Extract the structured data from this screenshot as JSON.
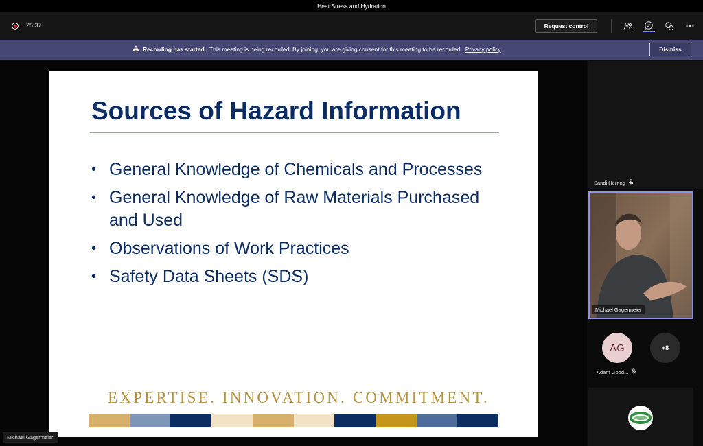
{
  "window": {
    "title": "Heat Stress and Hydration"
  },
  "meeting": {
    "timer": "25:37",
    "request_control_label": "Request control",
    "icons": [
      "people-icon",
      "chat-icon",
      "reactions-icon",
      "more-icon"
    ]
  },
  "banner": {
    "bold_text": "Recording has started.",
    "message": "This meeting is being recorded. By joining, you are giving consent for this meeting to be recorded.",
    "link_text": "Privacy policy",
    "dismiss_label": "Dismiss"
  },
  "slide": {
    "title": "Sources of Hazard Information",
    "bullets": [
      "General Knowledge of Chemicals and Processes",
      "General Knowledge of Raw Materials Purchased and Used",
      "Observations of Work Practices",
      "Safety Data Sheets (SDS)"
    ],
    "tagline": "EXPERTISE. INNOVATION. COMMITMENT.",
    "colorbar_colors": [
      "#d8b06a",
      "#7f96b8",
      "#0b2d63",
      "#f3e4c8",
      "#d8b06a",
      "#f3e4c8",
      "#0b2d63",
      "#c5951c",
      "#4e6d9c",
      "#0b2d63"
    ]
  },
  "presenter_label": "Michael Gagermeier",
  "participants": {
    "tile1_name": "Sandi Herring",
    "video_name": "Michael Gagermeier",
    "avatar_initials": "AG",
    "avatar_name": "Adam Good...",
    "more_count": "+8"
  },
  "colors": {
    "banner": "#464775",
    "accent": "#8b8fe6",
    "slide_title": "#0b2d63",
    "tagline": "#b8913e"
  }
}
